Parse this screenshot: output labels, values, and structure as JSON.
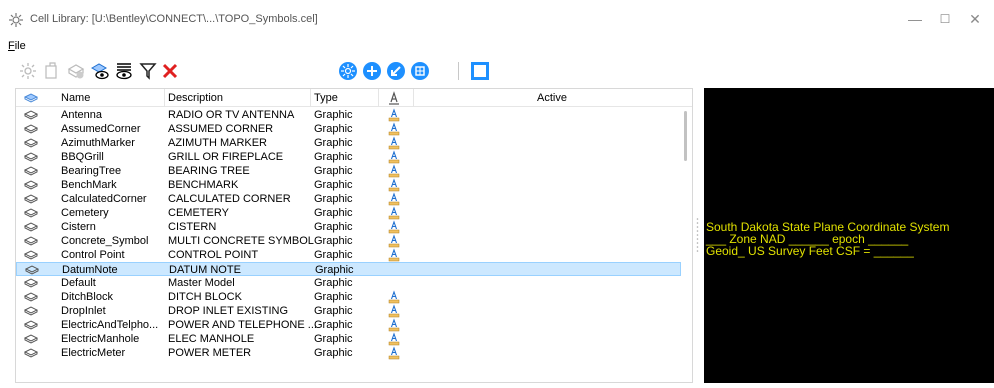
{
  "window": {
    "title": "Cell Library: [U:\\Bentley\\CONNECT\\...\\TOPO_Symbols.cel]",
    "minimize": "—",
    "maximize": "☐",
    "close": "✕"
  },
  "menu": {
    "file_u": "F",
    "file_rest": "ile"
  },
  "toolbar": {
    "icons": [
      "sun-icon",
      "new-cell-icon",
      "delete-cell-icon",
      "show-cells-icon",
      "preview-toggle-icon",
      "filter-icon",
      "close-x-icon",
      "placement-icon",
      "add-icon",
      "arrow-icon",
      "element-icon",
      "preview-pane-icon"
    ]
  },
  "columns": {
    "icon": "",
    "name": "Name",
    "description": "Description",
    "type": "Type",
    "active": "Active"
  },
  "rows": [
    {
      "name": "Antenna",
      "description": "RADIO OR TV ANTENNA",
      "type": "Graphic",
      "has_active": true
    },
    {
      "name": "AssumedCorner",
      "description": "ASSUMED CORNER",
      "type": "Graphic",
      "has_active": true
    },
    {
      "name": "AzimuthMarker",
      "description": "AZIMUTH MARKER",
      "type": "Graphic",
      "has_active": true
    },
    {
      "name": "BBQGrill",
      "description": "GRILL OR FIREPLACE",
      "type": "Graphic",
      "has_active": true
    },
    {
      "name": "BearingTree",
      "description": "BEARING TREE",
      "type": "Graphic",
      "has_active": true
    },
    {
      "name": "BenchMark",
      "description": "BENCHMARK",
      "type": "Graphic",
      "has_active": true
    },
    {
      "name": "CalculatedCorner",
      "description": "CALCULATED CORNER",
      "type": "Graphic",
      "has_active": true
    },
    {
      "name": "Cemetery",
      "description": "CEMETERY",
      "type": "Graphic",
      "has_active": true
    },
    {
      "name": "Cistern",
      "description": "CISTERN",
      "type": "Graphic",
      "has_active": true
    },
    {
      "name": "Concrete_Symbol",
      "description": "MULTI CONCRETE SYMBOL",
      "type": "Graphic",
      "has_active": true
    },
    {
      "name": "Control Point",
      "description": "CONTROL POINT",
      "type": "Graphic",
      "has_active": true
    },
    {
      "name": "DatumNote",
      "description": "DATUM NOTE",
      "type": "Graphic",
      "has_active": false,
      "selected": true
    },
    {
      "name": "Default",
      "description": "Master Model",
      "type": "Graphic",
      "has_active": false
    },
    {
      "name": "DitchBlock",
      "description": "DITCH BLOCK",
      "type": "Graphic",
      "has_active": true
    },
    {
      "name": "DropInlet",
      "description": "DROP INLET EXISTING",
      "type": "Graphic",
      "has_active": true
    },
    {
      "name": "ElectricAndTelpho...",
      "description": "POWER AND TELEPHONE ...",
      "type": "Graphic",
      "has_active": true
    },
    {
      "name": "ElectricManhole",
      "description": "ELEC MANHOLE",
      "type": "Graphic",
      "has_active": true
    },
    {
      "name": "ElectricMeter",
      "description": "POWER METER",
      "type": "Graphic",
      "has_active": true
    }
  ],
  "preview": {
    "line1": "South Dakota State Plane Coordinate System",
    "line2": "___ Zone  NAD ______ epoch ______",
    "line3": "Geoid_ US Survey Feet CSF = ______"
  },
  "colors": {
    "selection": "#cce8ff",
    "preview_bg": "#000000",
    "preview_text": "#e0e000",
    "toolbar_blue": "#1e90ff",
    "delete_red": "#e02020"
  }
}
